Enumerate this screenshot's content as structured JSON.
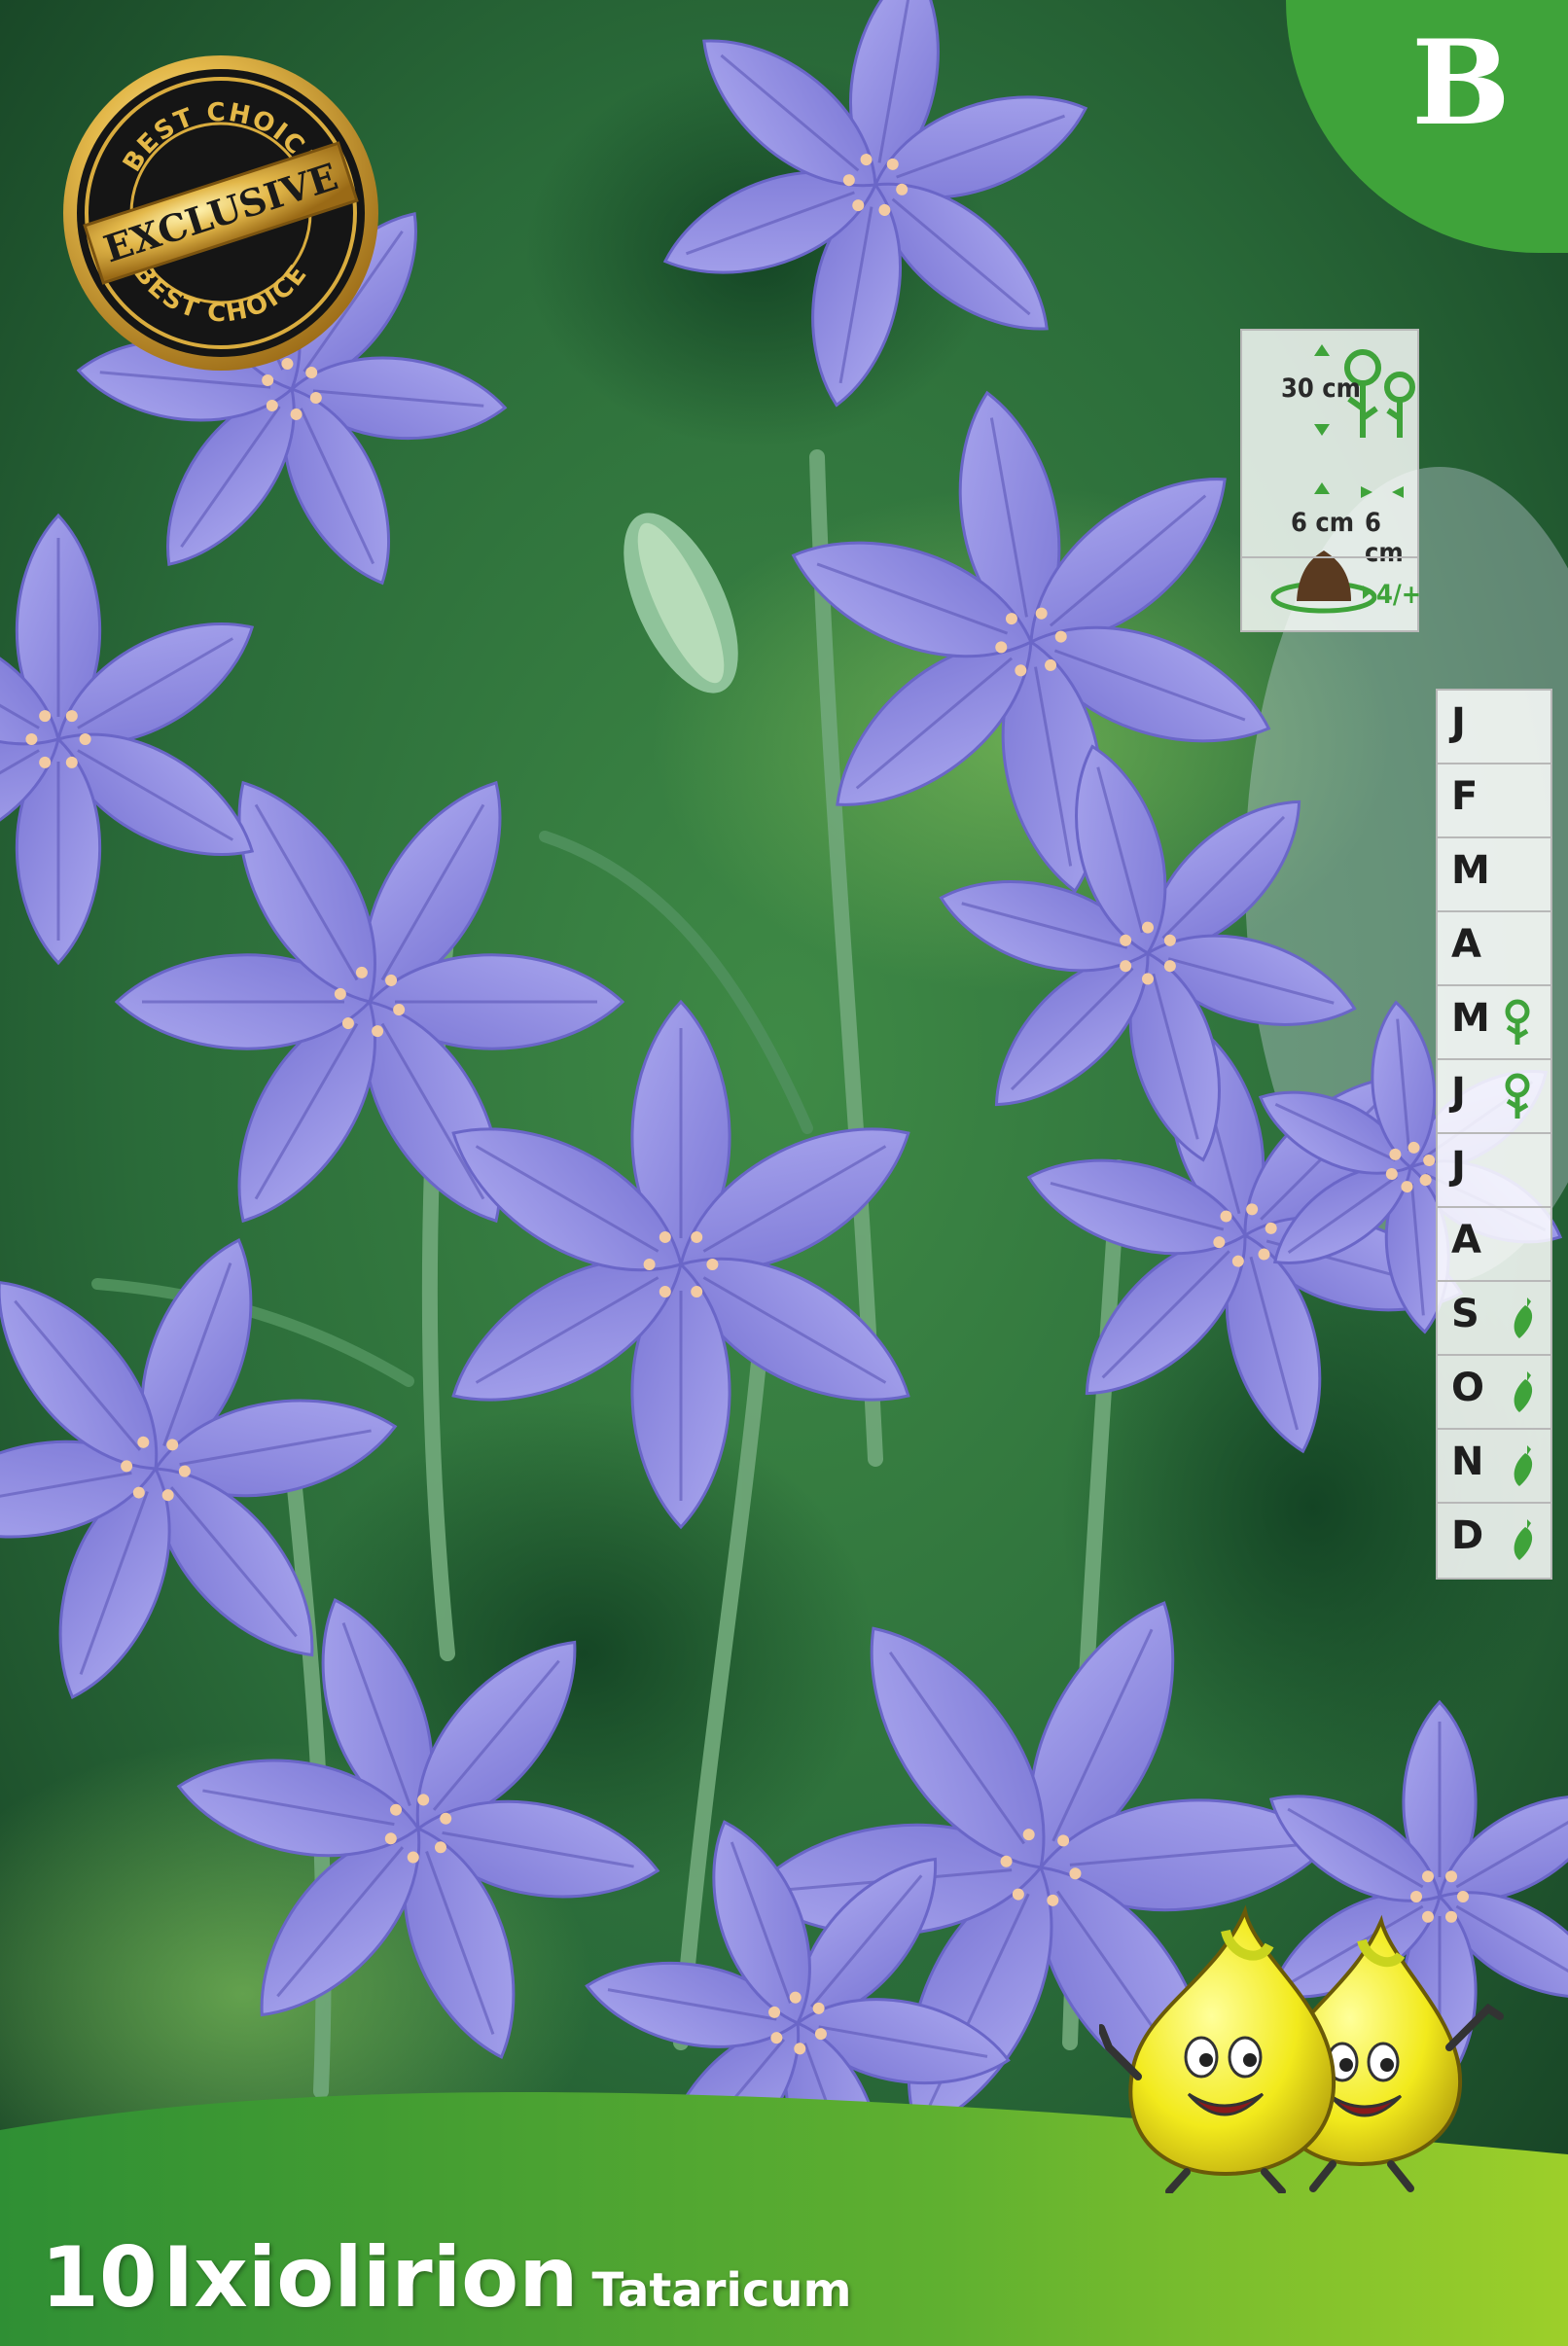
{
  "product": {
    "quantity": "10",
    "genus": "Ixiolirion",
    "species": "Tataricum"
  },
  "category_badge": "B",
  "seal": {
    "top_text": "BEST CHOICE",
    "center_text": "EXCLUSIVE",
    "bottom_text": "BEST CHOICE"
  },
  "planting_info": {
    "height": "30 cm",
    "depth": "6 cm",
    "spacing": "6 cm",
    "hardiness": "4/+"
  },
  "calendar": {
    "months": [
      {
        "letter": "J",
        "icon": ""
      },
      {
        "letter": "F",
        "icon": ""
      },
      {
        "letter": "M",
        "icon": ""
      },
      {
        "letter": "A",
        "icon": ""
      },
      {
        "letter": "M",
        "icon": "flower-icon"
      },
      {
        "letter": "J",
        "icon": "flower-icon"
      },
      {
        "letter": "J",
        "icon": ""
      },
      {
        "letter": "A",
        "icon": ""
      },
      {
        "letter": "S",
        "icon": "trowel-icon"
      },
      {
        "letter": "O",
        "icon": "trowel-icon"
      },
      {
        "letter": "N",
        "icon": "trowel-icon"
      },
      {
        "letter": "D",
        "icon": "trowel-icon"
      }
    ]
  },
  "colors": {
    "brand_green": "#3fa33a",
    "petal": "#8f8ee0",
    "foliage_dark": "#1f5a2e",
    "bar_green": "#6fbf2e"
  }
}
